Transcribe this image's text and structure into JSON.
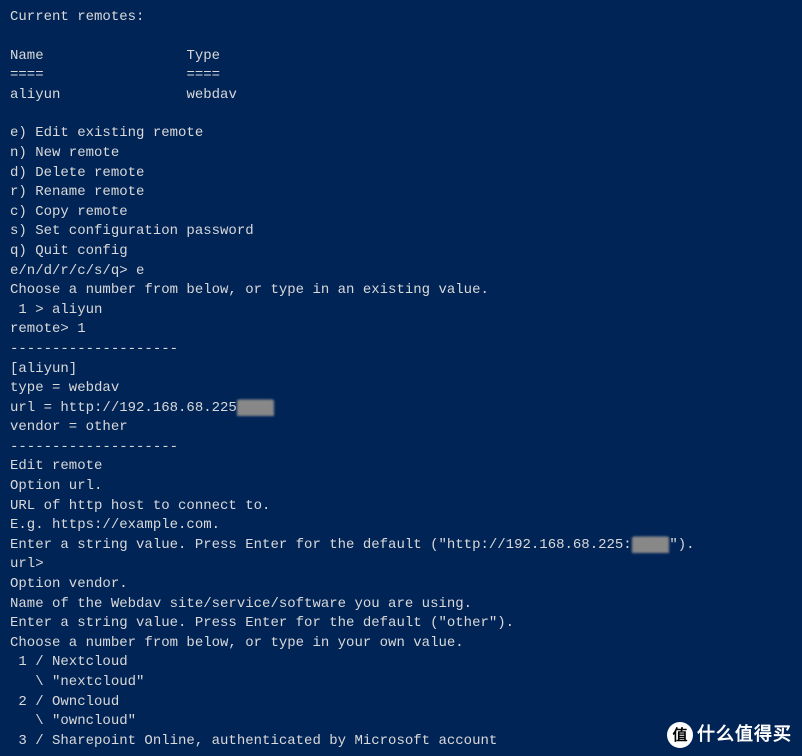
{
  "terminal": {
    "header": "Current remotes:",
    "table_name_header": "Name",
    "table_type_header": "Type",
    "table_name_divider": "====",
    "table_type_divider": "====",
    "remote_name": "aliyun",
    "remote_type": "webdav",
    "menu": {
      "e": "e) Edit existing remote",
      "n": "n) New remote",
      "d": "d) Delete remote",
      "r": "r) Rename remote",
      "c": "c) Copy remote",
      "s": "s) Set configuration password",
      "q": "q) Quit config"
    },
    "menu_prompt": "e/n/d/r/c/s/q> ",
    "menu_input": "e",
    "choose_msg": "Choose a number from below, or type in an existing value.",
    "choice_1": " 1 > aliyun",
    "remote_prompt": "remote> ",
    "remote_input": "1",
    "divider": "--------------------",
    "section_name": "[aliyun]",
    "config_type": "type = webdav",
    "config_url_prefix": "url = http://192.168.68.225",
    "config_url_redacted": "████",
    "config_vendor": "vendor = other",
    "edit_header": "Edit remote",
    "option_url": "Option url.",
    "url_desc": "URL of http host to connect to.",
    "url_example": "E.g. https://example.com.",
    "url_enter_prefix": "Enter a string value. Press Enter for the default (\"http://192.168.68.225:",
    "url_enter_redacted": "████",
    "url_enter_suffix": "\").",
    "url_prompt": "url>",
    "option_vendor": "Option vendor.",
    "vendor_desc": "Name of the Webdav site/service/software you are using.",
    "vendor_enter": "Enter a string value. Press Enter for the default (\"other\").",
    "vendor_choose": "Choose a number from below, or type in your own value.",
    "vendor_opt_1": " 1 / Nextcloud",
    "vendor_opt_1b": "   \\ \"nextcloud\"",
    "vendor_opt_2": " 2 / Owncloud",
    "vendor_opt_2b": "   \\ \"owncloud\"",
    "vendor_opt_3": " 3 / Sharepoint Online, authenticated by Microsoft account"
  },
  "watermark": {
    "circle_text": "值",
    "text": "什么值得买"
  }
}
